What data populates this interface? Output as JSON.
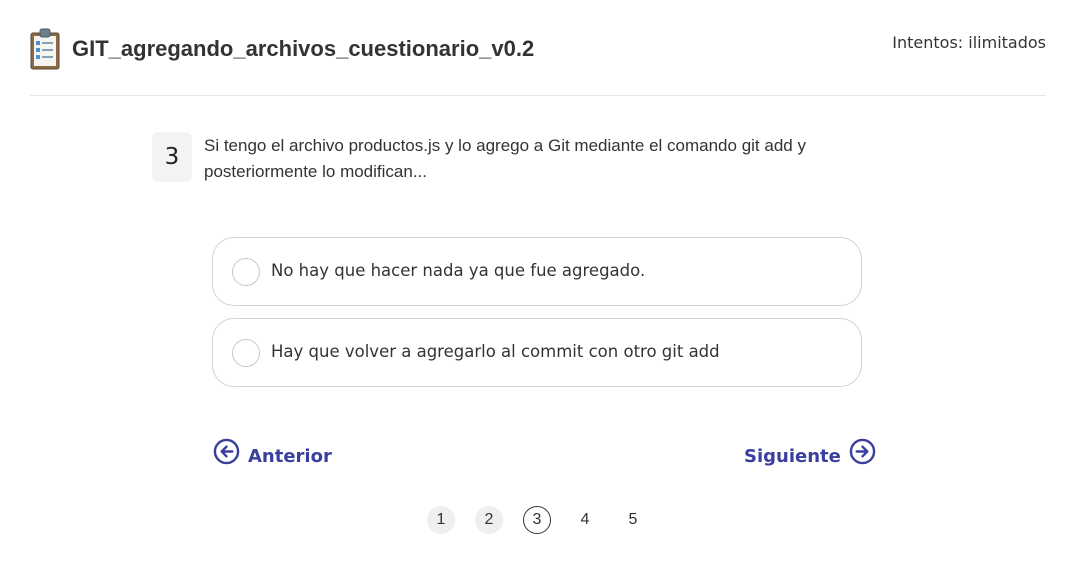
{
  "header": {
    "icon": "clipboard-checklist-icon",
    "title": "GIT_agregando_archivos_cuestionario_v0.2",
    "attempts": "Intentos: ilimitados"
  },
  "question": {
    "number": "3",
    "text": "Si tengo el archivo productos.js y lo agrego a Git mediante el comando git add y posteriormente lo modifican...",
    "options": [
      {
        "label": "No hay que hacer nada ya que fue agregado.",
        "selected": false
      },
      {
        "label": "Hay que volver a agregarlo al commit con otro git add",
        "selected": false
      }
    ]
  },
  "navigation": {
    "prev_label": "Anterior",
    "prev_icon": "arrow-left-circle-icon",
    "next_label": "Siguiente",
    "next_icon": "arrow-right-circle-icon",
    "accent_color": "#3a3f9e"
  },
  "pagination": {
    "pages": [
      "1",
      "2",
      "3",
      "4",
      "5"
    ],
    "current": "3",
    "visited": [
      "1",
      "2"
    ]
  }
}
